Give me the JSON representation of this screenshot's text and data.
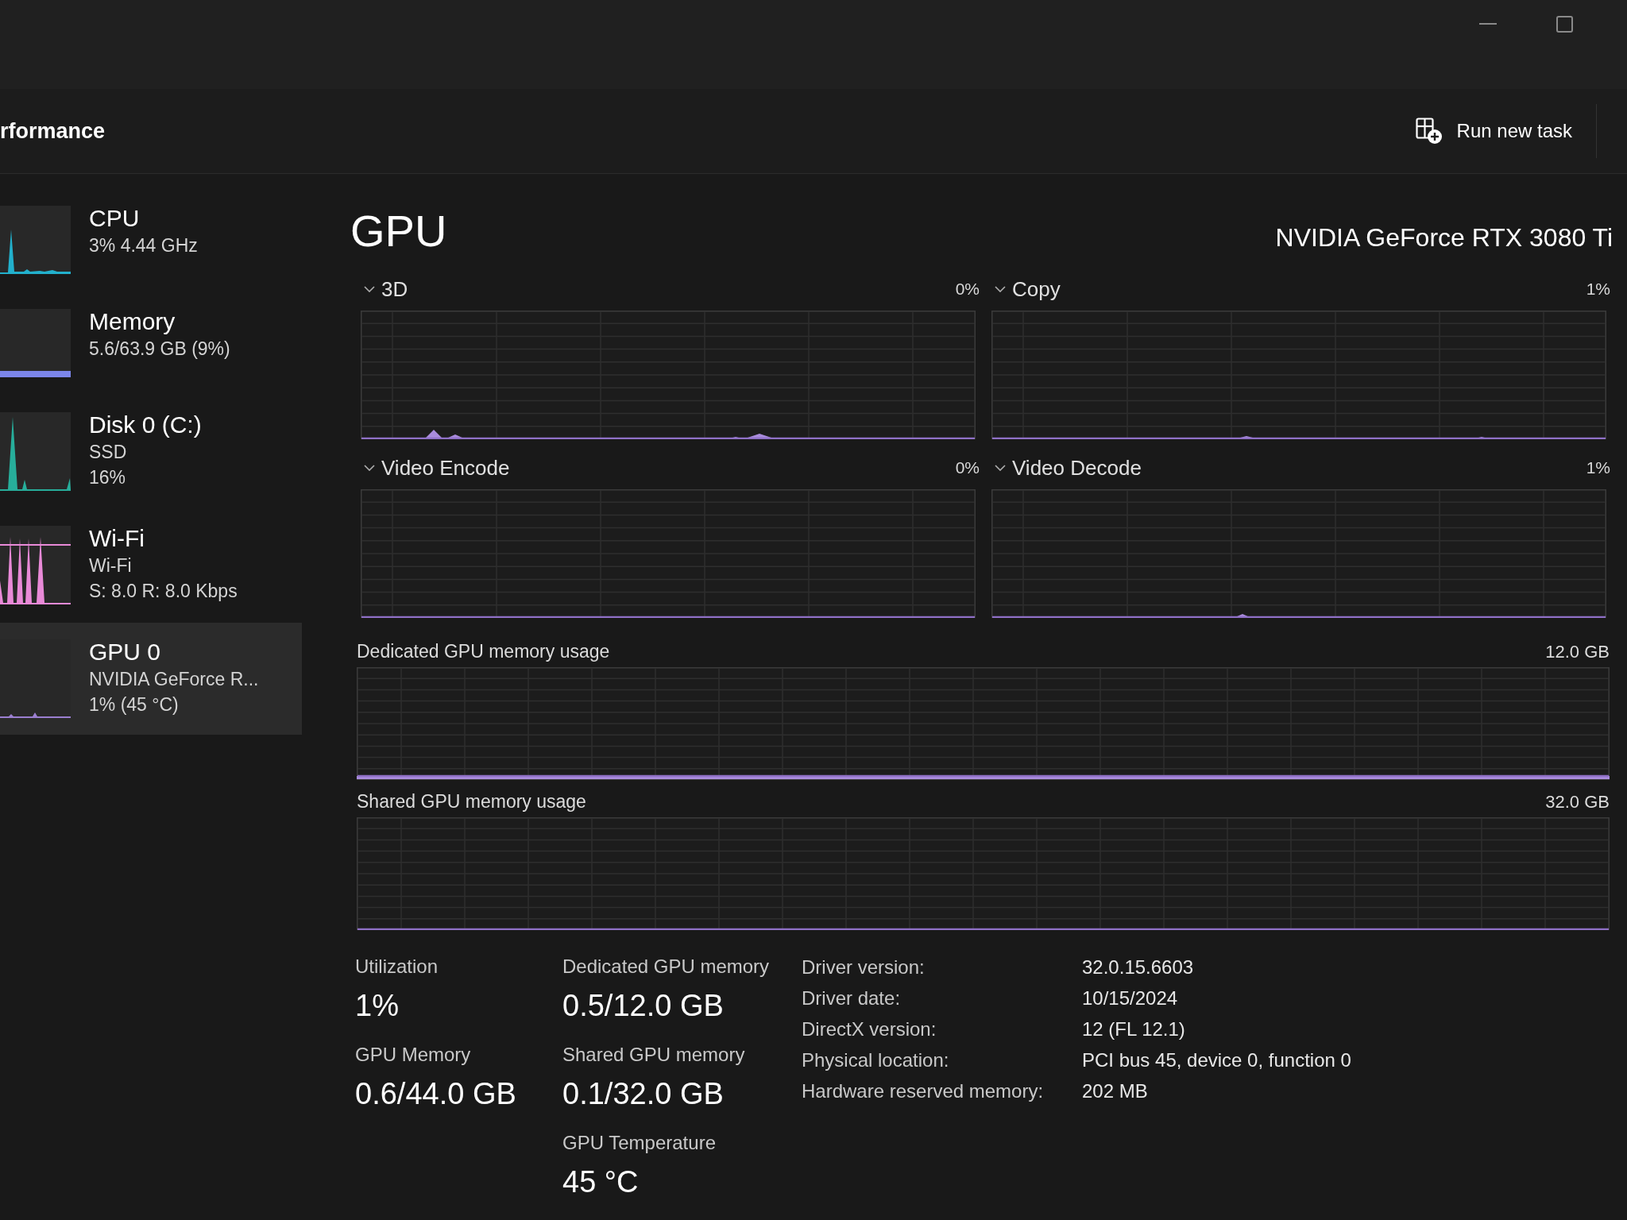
{
  "toolbar": {
    "title": "rformance",
    "run_task_button": {
      "label": "Run new task"
    }
  },
  "sidebar": {
    "items": [
      {
        "title": "CPU",
        "details": [
          "3% 4.44 GHz"
        ],
        "color": "#22b0cc",
        "selected": false
      },
      {
        "title": "Memory",
        "details": [
          "5.6/63.9 GB (9%)"
        ],
        "color": "#7c86ea",
        "selected": false
      },
      {
        "title": "Disk 0 (C:)",
        "details": [
          "SSD",
          "16%"
        ],
        "color": "#27ae9b",
        "selected": false
      },
      {
        "title": "Wi-Fi",
        "details": [
          "Wi-Fi",
          "S: 8.0 R: 8.0 Kbps"
        ],
        "color": "#e98ad8",
        "selected": false
      },
      {
        "title": "GPU 0",
        "details": [
          "NVIDIA GeForce R...",
          "1% (45 °C)"
        ],
        "color": "#9b7fd0",
        "selected": true
      }
    ]
  },
  "panel": {
    "title": "GPU",
    "device": "NVIDIA GeForce RTX 3080 Ti",
    "engines": [
      {
        "name": "3D",
        "value": "0%"
      },
      {
        "name": "Copy",
        "value": "1%"
      },
      {
        "name": "Video Encode",
        "value": "0%"
      },
      {
        "name": "Video Decode",
        "value": "1%"
      }
    ],
    "memory_graphs": [
      {
        "label": "Dedicated GPU memory usage",
        "max": "12.0 GB"
      },
      {
        "label": "Shared GPU memory usage",
        "max": "32.0 GB"
      }
    ],
    "stat_columns": [
      {
        "stats": [
          {
            "label": "Utilization",
            "value": "1%"
          },
          {
            "label": "GPU Memory",
            "value": "0.6/44.0 GB"
          }
        ]
      },
      {
        "stats": [
          {
            "label": "Dedicated GPU memory",
            "value": "0.5/12.0 GB"
          },
          {
            "label": "Shared GPU memory",
            "value": "0.1/32.0 GB"
          },
          {
            "label": "GPU Temperature",
            "value": "45 °C"
          }
        ]
      }
    ],
    "details": [
      {
        "label": "Driver version:",
        "value": "32.0.15.6603"
      },
      {
        "label": "Driver date:",
        "value": "10/15/2024"
      },
      {
        "label": "DirectX version:",
        "value": "12 (FL 12.1)"
      },
      {
        "label": "Physical location:",
        "value": "PCI bus 45, device 0, function 0"
      },
      {
        "label": "Hardware reserved memory:",
        "value": "202 MB"
      }
    ]
  }
}
